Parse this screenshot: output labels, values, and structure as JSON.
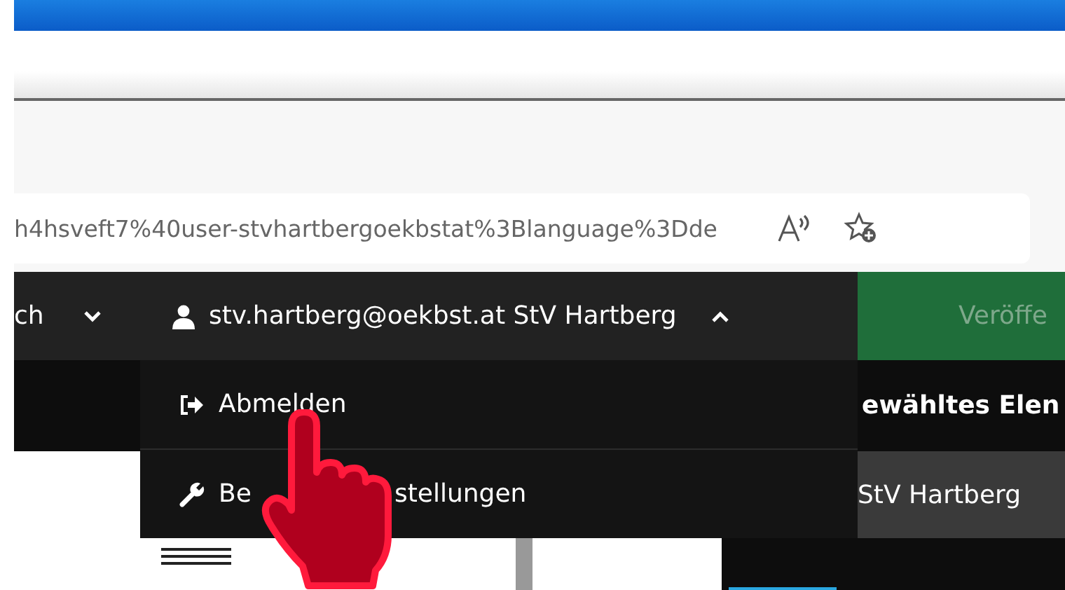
{
  "url_bar": {
    "url": "h4hsveft7%40user-stvhartbergoekbstat%3Blanguage%3Dde"
  },
  "navbar": {
    "language_menu": {
      "label": "ch",
      "expanded": false
    },
    "user_menu": {
      "label": "stv.hartberg@oekbst.at StV Hartberg",
      "expanded": true
    },
    "publish_button": {
      "label": "Veröffe",
      "disabled": true
    }
  },
  "user_dropdown": {
    "items": [
      {
        "kind": "logout",
        "label_parts": [
          "Abmelden"
        ]
      },
      {
        "kind": "settings",
        "label_parts": [
          "Be",
          "stellungen"
        ]
      }
    ]
  },
  "selected_element_panel": {
    "title": "ewähltes Elen",
    "value": "StV Hartberg"
  }
}
